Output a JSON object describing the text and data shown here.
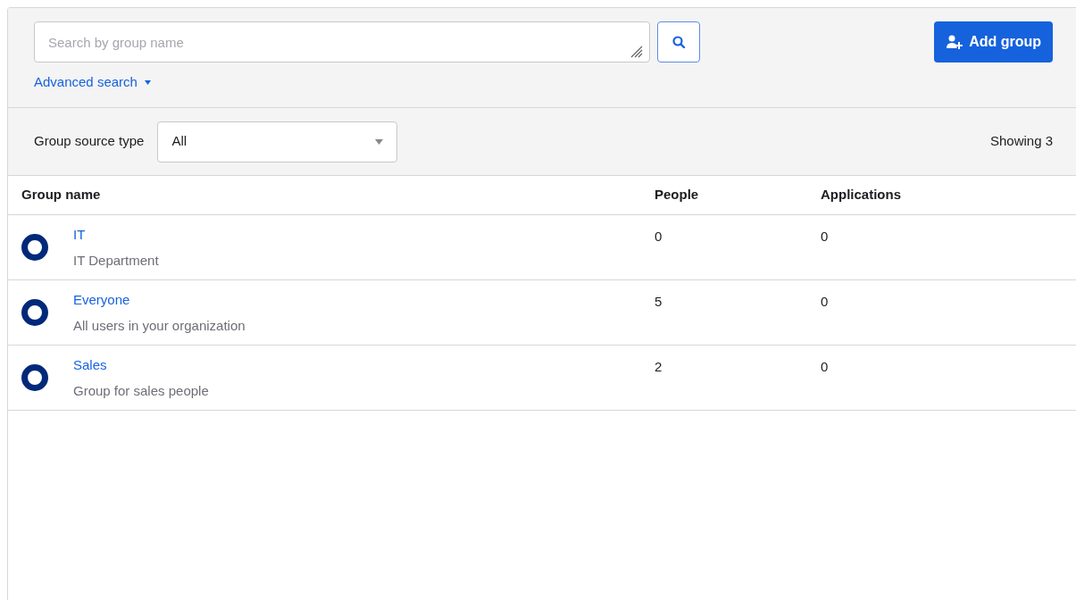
{
  "search": {
    "placeholder": "Search by group name"
  },
  "advanced_search": "Advanced search",
  "add_button": "Add group",
  "filter": {
    "label": "Group source type",
    "value": "All"
  },
  "showing": "Showing 3",
  "table": {
    "columns": [
      "Group name",
      "People",
      "Applications"
    ],
    "rows": [
      {
        "name": "IT",
        "description": "IT Department",
        "people": "0",
        "applications": "0"
      },
      {
        "name": "Everyone",
        "description": "All users in your organization",
        "people": "5",
        "applications": "0"
      },
      {
        "name": "Sales",
        "description": "Group for sales people",
        "people": "2",
        "applications": "0"
      }
    ]
  }
}
